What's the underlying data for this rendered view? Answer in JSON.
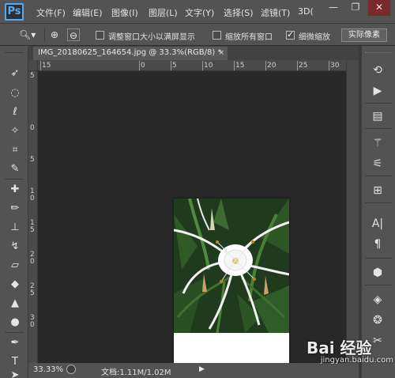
{
  "app": {
    "logo_text": "Ps"
  },
  "menu": [
    {
      "label": "文件(F)"
    },
    {
      "label": "编辑(E)"
    },
    {
      "label": "图像(I)"
    },
    {
      "label": "图层(L)"
    },
    {
      "label": "文字(Y)"
    },
    {
      "label": "选择(S)"
    },
    {
      "label": "滤镜(T)"
    },
    {
      "label": "3D("
    }
  ],
  "window_controls": {
    "minimize": "—",
    "restore": "❐",
    "close": "✕"
  },
  "options_bar": {
    "resize_windows_label": "调整窗口大小以满屏显示",
    "resize_windows_checked": false,
    "zoom_all_label": "缩放所有窗口",
    "zoom_all_checked": false,
    "scrubby_zoom_label": "细微缩放",
    "scrubby_zoom_checked": true,
    "actual_pixels_label": "实际像素"
  },
  "document_tab": {
    "title": "IMG_20180625_164654.jpg @ 33.3%(RGB/8) *",
    "close": "×"
  },
  "ruler": {
    "ticks": [
      "15",
      "0",
      "5",
      "10",
      "15",
      "20",
      "25",
      "30"
    ],
    "vertical_ticks": [
      "5",
      "0",
      "5",
      "1\n0",
      "1\n5",
      "2\n0",
      "2\n5",
      "3\n0"
    ]
  },
  "status": {
    "zoom": "33.33%",
    "doc_size": "文档:1.11M/1.02M"
  },
  "watermark": {
    "main": "Bai 经验",
    "sub": "jingyan.baidu.com"
  },
  "colors": {
    "ui_bg": "#535353",
    "canvas_bg": "#282828",
    "ps_blue": "#5aaaf0"
  }
}
